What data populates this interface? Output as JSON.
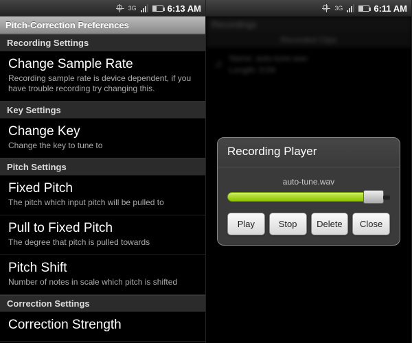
{
  "status_bar": {
    "left": {
      "time": "6:13 AM",
      "network_label": "3G"
    },
    "right": {
      "time": "6:11 AM",
      "network_label": "3G"
    }
  },
  "left_screen": {
    "title": "Pitch-Correction Preferences",
    "sections": [
      {
        "header": "Recording Settings",
        "items": [
          {
            "title": "Change Sample Rate",
            "subtitle": "Recording sample rate is device dependent, if you have trouble recording try changing this."
          }
        ]
      },
      {
        "header": "Key Settings",
        "items": [
          {
            "title": "Change Key",
            "subtitle": "Change the key to tune to"
          }
        ]
      },
      {
        "header": "Pitch Settings",
        "items": [
          {
            "title": "Fixed Pitch",
            "subtitle": "The pitch which input pitch will be pulled to"
          },
          {
            "title": "Pull to Fixed Pitch",
            "subtitle": "The degree that pitch is pulled towards"
          },
          {
            "title": "Pitch Shift",
            "subtitle": "Number of notes in scale which pitch is shifted"
          }
        ]
      },
      {
        "header": "Correction Settings",
        "items": [
          {
            "title": "Correction Strength",
            "subtitle": ""
          }
        ]
      }
    ]
  },
  "right_screen": {
    "bg": {
      "title": "Recordings",
      "section": "Recorded Clips",
      "item_name_label": "Name:",
      "item_name_value": "auto-tune.wav",
      "item_length_label": "Length:",
      "item_length_value": "0:04"
    },
    "dialog": {
      "title": "Recording Player",
      "filename": "auto-tune.wav",
      "progress_percent": 86,
      "buttons": {
        "play": "Play",
        "stop": "Stop",
        "delete": "Delete",
        "close": "Close"
      }
    }
  }
}
